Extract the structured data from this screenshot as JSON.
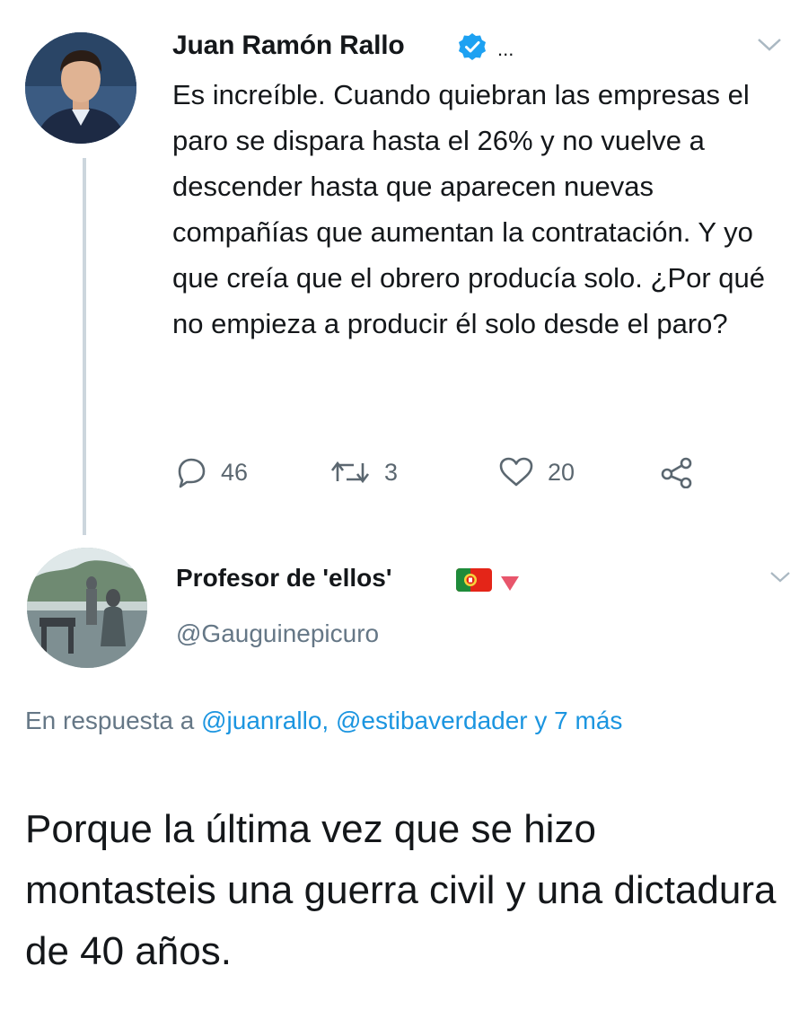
{
  "tweet": {
    "author_name": "Juan Ramón Rallo",
    "verified": true,
    "more_label": "...",
    "text": "Es increíble. Cuando quiebran las empresas el paro se dispara hasta el 26% y no vuelve a descender hasta que aparecen nuevas compañías que aumentan la contratación. Y yo que creía que el obrero producía solo. ¿Por qué no empieza a producir él solo desde el paro?",
    "actions": {
      "replies": "46",
      "retweets": "3",
      "likes": "20"
    }
  },
  "reply": {
    "author_name": "Profesor de 'ellos'",
    "handle": "@Gauguinepicuro",
    "in_reply_to_prefix": "En respuesta a",
    "mention_1": "@juanrallo,",
    "mention_2": "@estibaverdader",
    "in_reply_to_suffix": "y 7 más",
    "text": "Porque la última vez que se hizo montasteis una guerra civil y una dictadura de 40 años."
  },
  "colors": {
    "text": "#14171a",
    "muted": "#657786",
    "link": "#1b95e0",
    "verified": "#1da1f2",
    "thread_line": "#ccd6dd"
  }
}
